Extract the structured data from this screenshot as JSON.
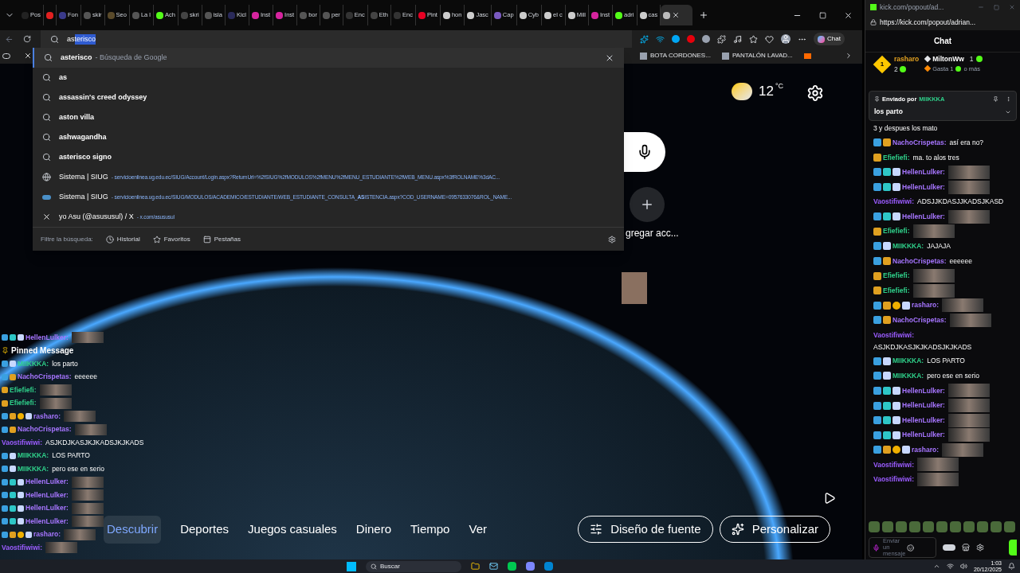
{
  "tabs": [
    {
      "label": "Pos",
      "color": "#222222",
      "selected": false
    },
    {
      "color": "#e02020",
      "selected": false
    },
    {
      "label": "Fon",
      "color": "#3a3a8a",
      "selected": false
    },
    {
      "label": "skir",
      "color": "#555555",
      "selected": false
    },
    {
      "label": "Seo",
      "color": "#5a4a2a",
      "selected": false
    },
    {
      "label": "La l",
      "color": "#555555",
      "selected": false
    },
    {
      "label": "Ach",
      "color": "#53fc18",
      "selected": false
    },
    {
      "label": "skri",
      "color": "#444444",
      "selected": false
    },
    {
      "label": "isla",
      "color": "#555555",
      "selected": false
    },
    {
      "label": "Kicl",
      "color": "#2a2a5a",
      "selected": false
    },
    {
      "label": "Inst",
      "color": "#d6249f",
      "selected": false
    },
    {
      "label": "Inst",
      "color": "#d6249f",
      "selected": false
    },
    {
      "label": "bor",
      "color": "#555555",
      "selected": false
    },
    {
      "label": "per",
      "color": "#555555",
      "selected": false
    },
    {
      "label": "Enc",
      "color": "#333333",
      "selected": false
    },
    {
      "label": "Eth",
      "color": "#444444",
      "selected": false
    },
    {
      "label": "Enc",
      "color": "#333333",
      "selected": false
    },
    {
      "label": "Pint",
      "color": "#e60023",
      "selected": false
    },
    {
      "label": "hon",
      "color": "#cccccc",
      "selected": false
    },
    {
      "label": "Jasc",
      "color": "#cccccc",
      "selected": false
    },
    {
      "label": "Cap",
      "color": "#7a5ac0",
      "selected": false
    },
    {
      "label": "Cyb",
      "color": "#cccccc",
      "selected": false
    },
    {
      "label": "el c",
      "color": "#cccccc",
      "selected": false
    },
    {
      "label": "Mill",
      "color": "#cccccc",
      "selected": false
    },
    {
      "label": "Inst",
      "color": "#d6249f",
      "selected": false
    },
    {
      "label": "adri",
      "color": "#53fc18",
      "selected": false
    },
    {
      "label": "cas",
      "color": "#cccccc",
      "selected": false
    },
    {
      "color": "#bbbbbb",
      "selected": true
    }
  ],
  "address": {
    "typed": "as",
    "completion": "terisco"
  },
  "toolbar": {
    "chat_button": "Chat"
  },
  "favorites": [
    "BOTA CORDONES...",
    "PANTALÓN LAVAD..."
  ],
  "dropdown": {
    "items": [
      {
        "kind": "search",
        "text": "asterisco",
        "detail": "- Búsqueda de Google",
        "selected": true
      },
      {
        "kind": "search",
        "text": "as",
        "selected": false
      },
      {
        "kind": "search",
        "text": "assassin's creed odyssey",
        "selected": false
      },
      {
        "kind": "search",
        "text": "aston villa",
        "selected": false
      },
      {
        "kind": "search",
        "text": "ashwagandha",
        "selected": false
      },
      {
        "kind": "search",
        "text": "asterisco signo",
        "selected": false
      },
      {
        "kind": "site",
        "text": "Sistema | SIUG",
        "detail": "- servicioenlinea.ug.edu.ec/SIUG/Account/Login.aspx?ReturnUrl=%2fSIUG%2fMODULOS%2fMENU%2fMENU_ESTUDIANTE%2fWEB_MENU.aspx%3fROLNAME%3dAC...",
        "selected": false
      },
      {
        "kind": "ug",
        "text": "Sistema | SIUG",
        "detail": "- servicioenlinea.ug.edu.ec/SIUG/MODULOS/ACADEMICO/ESTUDIANTE/WEB_ESTUDIANTE_CONSULTA_**AS**ISTENCIA.aspx?COD_USERNAME=0957633076&ROL_NAME...",
        "selected": false
      },
      {
        "kind": "x",
        "text": "yo Asu (@asususul) / X",
        "detail": "- x.com/asususul",
        "selected": false
      }
    ],
    "filter_label": "Filtre la búsqueda:",
    "filters": [
      "Historial",
      "Favoritos",
      "Pestañas"
    ]
  },
  "newtab": {
    "temperature": "12",
    "unit": "°C",
    "add_shortcut": "gregar acc...",
    "nav": [
      {
        "label": "Descubrir",
        "selected": true
      },
      {
        "label": "Deportes",
        "selected": false
      },
      {
        "label": "Juegos casuales",
        "selected": false
      },
      {
        "label": "Dinero",
        "selected": false
      },
      {
        "label": "Tiempo",
        "selected": false
      },
      {
        "label": "Ver",
        "selected": false
      }
    ],
    "buttons": [
      "Diseño de fuente",
      "Personalizar"
    ]
  },
  "overlay_chat": {
    "pinned_label": "Pinned Message",
    "messages": [
      {
        "user": "HellenLulker:",
        "color": "#a675ff",
        "badges": [
          {
            "kind": "mod"
          },
          {
            "kind": "og"
          },
          {
            "kind": "gift"
          }
        ],
        "emote": true
      },
      {
        "kind": "pinned"
      },
      {
        "user": "MIIKKKA:",
        "color": "#2fd08a",
        "badges": [
          {
            "kind": "mod"
          },
          {
            "kind": "gift"
          }
        ],
        "text": "los parto"
      },
      {
        "user": "NachoCrispetas:",
        "color": "#a675ff",
        "badges": [
          {
            "kind": "mod"
          },
          {
            "kind": "sub"
          }
        ],
        "text": "eeeeee"
      },
      {
        "user": "Efiefiefi:",
        "color": "#2fd08a",
        "badges": [
          {
            "kind": "sub"
          }
        ],
        "emote": true
      },
      {
        "user": "Efiefiefi:",
        "color": "#2fd08a",
        "badges": [
          {
            "kind": "sub"
          }
        ],
        "emote": true
      },
      {
        "user": "rasharo:",
        "color": "#a675ff",
        "badges": [
          {
            "kind": "mod"
          },
          {
            "kind": "sub"
          },
          {
            "kind": "one"
          },
          {
            "kind": "gift"
          }
        ],
        "emote": true
      },
      {
        "user": "NachoCrispetas:",
        "color": "#a675ff",
        "badges": [
          {
            "kind": "mod"
          },
          {
            "kind": "sub"
          }
        ],
        "emote": true
      },
      {
        "user": "Vaostifiwiwi:",
        "color": "#9b5cff",
        "text": "ASJKDJKASJKJKADSJKJKADS"
      },
      {
        "user": "MIIKKKA:",
        "color": "#2fd08a",
        "badges": [
          {
            "kind": "mod"
          },
          {
            "kind": "gift"
          }
        ],
        "text": "LOS PARTO"
      },
      {
        "user": "MIIKKKA:",
        "color": "#2fd08a",
        "badges": [
          {
            "kind": "mod"
          },
          {
            "kind": "gift"
          }
        ],
        "text": "pero ese en serio"
      },
      {
        "user": "HellenLulker:",
        "color": "#a675ff",
        "badges": [
          {
            "kind": "mod"
          },
          {
            "kind": "og"
          },
          {
            "kind": "gift"
          }
        ],
        "emote": true
      },
      {
        "user": "HellenLulker:",
        "color": "#a675ff",
        "badges": [
          {
            "kind": "mod"
          },
          {
            "kind": "og"
          },
          {
            "kind": "gift"
          }
        ],
        "emote": true
      },
      {
        "user": "HellenLulker:",
        "color": "#a675ff",
        "badges": [
          {
            "kind": "mod"
          },
          {
            "kind": "og"
          },
          {
            "kind": "gift"
          }
        ],
        "emote": true
      },
      {
        "user": "HellenLulker:",
        "color": "#a675ff",
        "badges": [
          {
            "kind": "mod"
          },
          {
            "kind": "og"
          },
          {
            "kind": "gift"
          }
        ],
        "emote": true
      },
      {
        "user": "rasharo:",
        "color": "#a675ff",
        "badges": [
          {
            "kind": "mod"
          },
          {
            "kind": "sub"
          },
          {
            "kind": "one"
          },
          {
            "kind": "gift"
          }
        ],
        "emote": true
      },
      {
        "user": "Vaostifiwiwi:",
        "color": "#9b5cff",
        "emote": true
      }
    ]
  },
  "popup": {
    "title": "kick.com/popout/ad...",
    "url": "https://kick.com/popout/adrian...",
    "header": "Chat",
    "leaders": [
      {
        "user": "rasharo",
        "rank": "1",
        "count": "2"
      },
      {
        "user": "MiltonWw",
        "count": "1"
      }
    ],
    "spend": [
      "Gasta 1",
      "o más"
    ],
    "pinned": {
      "sent_by": "Enviado por",
      "user": "MIIKKKA",
      "text": "los parto"
    },
    "messages": [
      {
        "text": "3 y despues los mato"
      },
      {
        "user": "NachoCrispetas:",
        "color": "#a675ff",
        "badges": [
          {
            "kind": "mod"
          },
          {
            "kind": "sub"
          }
        ],
        "text": "así era no?"
      },
      {
        "user": "Efiefiefi:",
        "color": "#2fd08a",
        "badges": [
          {
            "kind": "sub"
          }
        ],
        "text": "ma. to alos tres"
      },
      {
        "user": "HellenLulker:",
        "color": "#a675ff",
        "badges": [
          {
            "kind": "mod"
          },
          {
            "kind": "og"
          },
          {
            "kind": "gift"
          }
        ],
        "emote": true
      },
      {
        "user": "HellenLulker:",
        "color": "#a675ff",
        "badges": [
          {
            "kind": "mod"
          },
          {
            "kind": "og"
          },
          {
            "kind": "gift"
          }
        ],
        "emote": true
      },
      {
        "user": "Vaostifiwiwi:",
        "color": "#9b5cff",
        "text": "ADSJJKDASJJKADSJKASD"
      },
      {
        "user": "HellenLulker:",
        "color": "#a675ff",
        "badges": [
          {
            "kind": "mod"
          },
          {
            "kind": "og"
          },
          {
            "kind": "gift"
          }
        ],
        "emote": true
      },
      {
        "user": "Efiefiefi:",
        "color": "#2fd08a",
        "badges": [
          {
            "kind": "sub"
          }
        ],
        "emote": true
      },
      {
        "user": "MIIKKKA:",
        "color": "#2fd08a",
        "badges": [
          {
            "kind": "mod"
          },
          {
            "kind": "gift"
          }
        ],
        "text": "JAJAJA"
      },
      {
        "user": "NachoCrispetas:",
        "color": "#a675ff",
        "badges": [
          {
            "kind": "mod"
          },
          {
            "kind": "sub"
          }
        ],
        "text": "eeeeee"
      },
      {
        "user": "Efiefiefi:",
        "color": "#2fd08a",
        "badges": [
          {
            "kind": "sub"
          }
        ],
        "emote": true
      },
      {
        "user": "Efiefiefi:",
        "color": "#2fd08a",
        "badges": [
          {
            "kind": "sub"
          }
        ],
        "emote": true
      },
      {
        "user": "rasharo:",
        "color": "#a675ff",
        "badges": [
          {
            "kind": "mod"
          },
          {
            "kind": "sub"
          },
          {
            "kind": "one"
          },
          {
            "kind": "gift"
          }
        ],
        "emote": true
      },
      {
        "user": "NachoCrispetas:",
        "color": "#a675ff",
        "badges": [
          {
            "kind": "mod"
          },
          {
            "kind": "sub"
          }
        ],
        "emote": true
      },
      {
        "user": "Vaostifiwiwi:",
        "color": "#9b5cff",
        "text": "ASJKDJKASJKJKADSJKJKADS",
        "wrap": true
      },
      {
        "user": "MIIKKKA:",
        "color": "#2fd08a",
        "badges": [
          {
            "kind": "mod"
          },
          {
            "kind": "gift"
          }
        ],
        "text": "LOS PARTO"
      },
      {
        "user": "MIIKKKA:",
        "color": "#2fd08a",
        "badges": [
          {
            "kind": "mod"
          },
          {
            "kind": "gift"
          }
        ],
        "text": "pero ese en serio"
      },
      {
        "user": "HellenLulker:",
        "color": "#a675ff",
        "badges": [
          {
            "kind": "mod"
          },
          {
            "kind": "og"
          },
          {
            "kind": "gift"
          }
        ],
        "emote": true
      },
      {
        "user": "HellenLulker:",
        "color": "#a675ff",
        "badges": [
          {
            "kind": "mod"
          },
          {
            "kind": "og"
          },
          {
            "kind": "gift"
          }
        ],
        "emote": true
      },
      {
        "user": "HellenLulker:",
        "color": "#a675ff",
        "badges": [
          {
            "kind": "mod"
          },
          {
            "kind": "og"
          },
          {
            "kind": "gift"
          }
        ],
        "emote": true
      },
      {
        "user": "HellenLulker:",
        "color": "#a675ff",
        "badges": [
          {
            "kind": "mod"
          },
          {
            "kind": "og"
          },
          {
            "kind": "gift"
          }
        ],
        "emote": true
      },
      {
        "user": "rasharo:",
        "color": "#a675ff",
        "badges": [
          {
            "kind": "mod"
          },
          {
            "kind": "sub"
          },
          {
            "kind": "one"
          },
          {
            "kind": "gift"
          }
        ],
        "emote": true
      },
      {
        "user": "Vaostifiwiwi:",
        "color": "#9b5cff",
        "emote": true
      },
      {
        "user": "Vaostifiwiwi:",
        "color": "#9b5cff",
        "emote": true
      }
    ],
    "input_placeholder": "Enviar un mensaje"
  },
  "taskbar": {
    "search": "Buscar",
    "time": "1:03",
    "date": "20/12/2025"
  }
}
